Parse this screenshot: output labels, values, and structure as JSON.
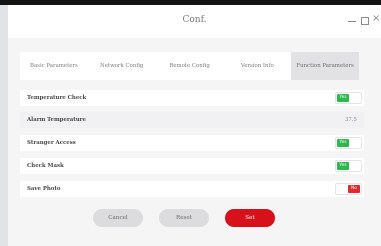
{
  "window": {
    "title": "Conf.",
    "controls": {
      "minimize": "–",
      "maximize": "□",
      "close": "×"
    }
  },
  "tabs": [
    {
      "label": "Basic Parameters",
      "active": false
    },
    {
      "label": "Network Config",
      "active": false
    },
    {
      "label": "Remote Config",
      "active": false
    },
    {
      "label": "Version Info",
      "active": false
    },
    {
      "label": "Function Parameters",
      "active": true
    }
  ],
  "settings": {
    "temperature_check": {
      "label": "Temperature Check",
      "toggle": "Yes"
    },
    "alarm_temperature": {
      "label": "Alarm Temperature",
      "value": "37.5"
    },
    "stranger_access": {
      "label": "Stranger Access",
      "toggle": "Yes"
    },
    "check_mask": {
      "label": "Check Mask",
      "toggle": "Yes"
    },
    "save_photo": {
      "label": "Save Photo",
      "toggle": "No"
    }
  },
  "buttons": {
    "cancel": "Cancel",
    "reset": "Reset",
    "set": "Set"
  },
  "colors": {
    "accent": "#d7111c",
    "on": "#2db84d",
    "off": "#e02b2b"
  }
}
